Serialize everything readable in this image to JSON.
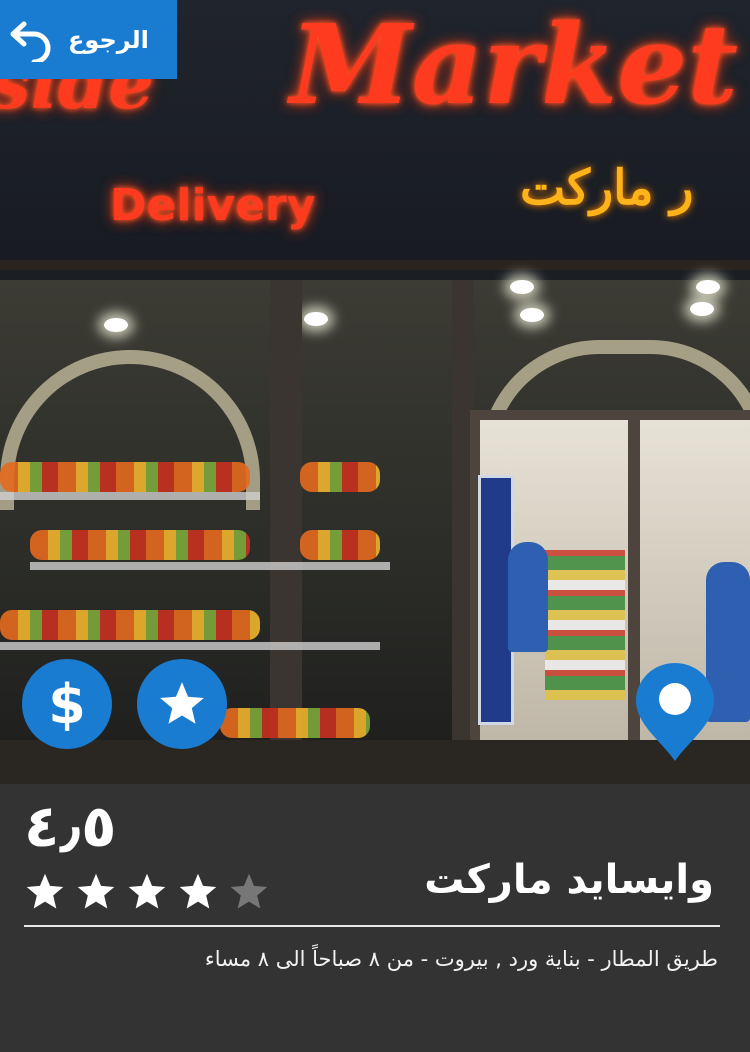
{
  "photo": {
    "sign_text_side": "side",
    "sign_text_market": "Market",
    "sign_text_delivery": "Delivery",
    "sign_text_arabic": "ر ماركت"
  },
  "header": {
    "back_label": "الرجوع",
    "back_icon": "back-arrow-icon",
    "accent_color": "#1a7cd0"
  },
  "actions": {
    "price_symbol": "$",
    "price_icon": "dollar-icon",
    "rating_icon": "star-icon",
    "location_icon": "map-pin-icon"
  },
  "store": {
    "rating_text": "٤٫٥",
    "rating_value": 4.5,
    "stars_filled": 4,
    "stars_total": 5,
    "name": "وايسايد ماركت",
    "address": "طريق المطار - بناية ورد , بيروت - من ٨ صباحاً الى ٨ مساء"
  },
  "colors": {
    "panel_background": "#333333",
    "star_filled": "#ffffff",
    "star_empty": "#777777"
  }
}
